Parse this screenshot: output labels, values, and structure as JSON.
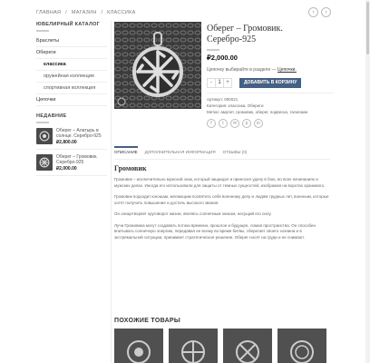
{
  "breadcrumb": [
    "ГЛАВНАЯ",
    "/",
    "МАГАЗИН",
    "/",
    "КЛАССИКА"
  ],
  "nav": {
    "prev": "‹",
    "next": "›"
  },
  "sidebar": {
    "catalog_title": "ЮВЕЛИРНЫЙ КАТАЛОГ",
    "categories": [
      {
        "label": "Браслеты"
      },
      {
        "label": "Обереги"
      },
      {
        "label": "классика"
      },
      {
        "label": "оружейная коллекция"
      },
      {
        "label": "спортивная коллекция"
      },
      {
        "label": "Цепочки"
      }
    ],
    "recent_title": "НЕДАВНИЕ",
    "recent": [
      {
        "name": "Оберег – Алатырь в солнце. Серебро-925",
        "price": "₽2,800.00"
      },
      {
        "name": "Оберег – Громовик. Серебро-925",
        "price": "₽2,000.00"
      }
    ]
  },
  "product": {
    "title": "Оберег – Громовик. Серебро-925",
    "price": "₽2,000.00",
    "note_prefix": "Цепочку выбирайте в разделе —",
    "note_link": "Цепочки.",
    "qty_minus": "-",
    "qty_value": "1",
    "qty_plus": "+",
    "add_to_cart": "ДОБАВИТЬ В КОРЗИНУ",
    "sku": "Артикул: 000021",
    "category": "Категория: классика, Обереги",
    "tags": "Метки: амулет, громовик, оберег, подвеска, талисман",
    "share_icons": [
      "f",
      "t",
      "✉",
      "p",
      "in"
    ]
  },
  "tabs": [
    "ОПИСАНИЕ",
    "ДОПОЛНИТЕЛЬНАЯ ИНФОРМАЦИЯ",
    "ОТЗЫВЫ (0)"
  ],
  "description": {
    "heading": "Громовик",
    "paragraphs": [
      "Громовик – исключительно мужской знак, который защищал и приносил удачу в бою, во всех начинаниях и мужских делах. Иногда его использовали для защиты от темных сущностей, изображая на воротах хранимого.",
      "Громовик подходит юношам, желающим посвятить себя военному делу и людям трудных лет, военным, которые хотят получить повышение и достичь высокого звания.",
      "Он олицетворяет круговорот жизни, являясь солнечным знаком, несущий его силу.",
      "Лучи Громовика могут создавать потоки времени, прошлое и будущее, ломая пространства. Он способен впитывать солнечную энергию, передавая ее всему во время битвы, сберегает своего хозяина и в экстремальной ситуации, принимает стратегическое решение. Оберег носят на груди и не снимают."
    ]
  },
  "related": {
    "title": "ПОХОЖИЕ ТОВАРЫ"
  },
  "colors": {
    "accent": "#446084",
    "image_bg": "#3b3b3b"
  }
}
